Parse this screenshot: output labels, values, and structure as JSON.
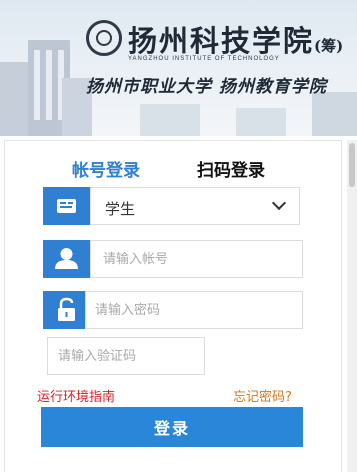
{
  "banner": {
    "school_name": "扬州科技学院",
    "school_name_suffix": "(筹)",
    "school_name_en": "YANGZHOU INSTITUTE OF TECHNOLOGY",
    "school_subtitle": "扬州市职业大学  扬州教育学院"
  },
  "login": {
    "tabs": [
      "帐号登录",
      "扫码登录"
    ],
    "active_tab": "帐号登录",
    "role_select": {
      "value": "学生",
      "icon": "id-card-icon"
    },
    "account_field": {
      "placeholder": "请输入帐号",
      "icon": "user-icon"
    },
    "password_field": {
      "placeholder": "请输入密码",
      "icon": "lock-icon"
    },
    "captcha_field": {
      "placeholder": "请输入验证码"
    },
    "env_guide_link": "运行环境指南",
    "forgot_password_link": "忘记密码?",
    "submit_label": "登录"
  },
  "colors": {
    "accent": "#2f7fd3",
    "button": "#2a86d8",
    "env_link": "#e02020",
    "forgot_link": "#d9761a"
  }
}
